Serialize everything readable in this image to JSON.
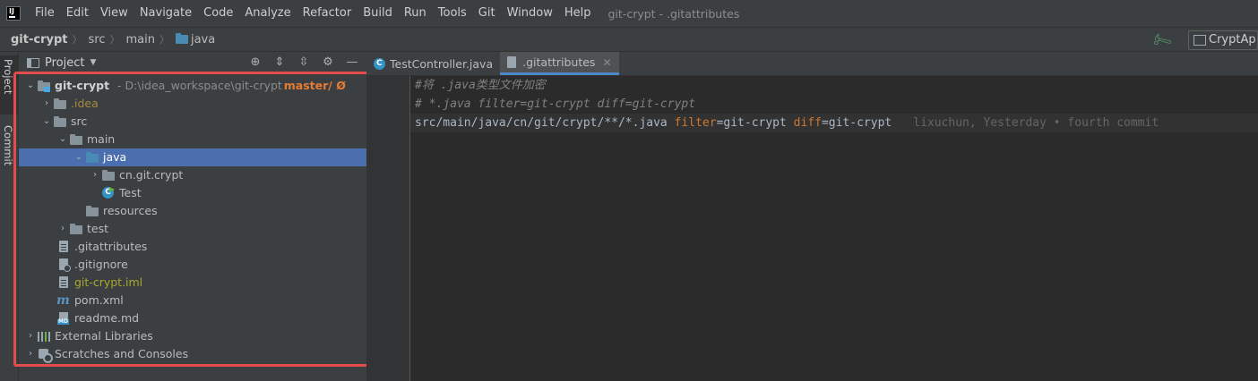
{
  "menubar": {
    "items": [
      "File",
      "Edit",
      "View",
      "Navigate",
      "Code",
      "Analyze",
      "Refactor",
      "Build",
      "Run",
      "Tools",
      "Git",
      "Window",
      "Help"
    ],
    "window_title": "git-crypt - .gitattributes"
  },
  "navbar": {
    "crumbs": [
      "git-crypt",
      "src",
      "main",
      "java"
    ],
    "run_config": "CryptAp"
  },
  "side_strip": {
    "project": "Project",
    "commit": "Commit"
  },
  "project_panel": {
    "title": "Project",
    "tree": {
      "root_name": "git-crypt",
      "root_path": "- D:\\idea_workspace\\git-crypt",
      "root_branch": "master/ Ø",
      "idea": ".idea",
      "src": "src",
      "main": "main",
      "java": "java",
      "pkg": "cn.git.crypt",
      "test_class": "Test",
      "resources": "resources",
      "test": "test",
      "gitattributes": ".gitattributes",
      "gitignore": ".gitignore",
      "iml": "git-crypt.iml",
      "pom": "pom.xml",
      "readme": "readme.md",
      "ext_libs": "External Libraries",
      "scratches": "Scratches and Consoles"
    }
  },
  "editor": {
    "tabs": [
      "TestController.java",
      ".gitattributes"
    ],
    "active_tab": 1,
    "lines": {
      "l1": "#将 .java类型文件加密",
      "l2": "# *.java filter=git-crypt diff=git-crypt",
      "l3_path": "src/main/java/cn/git/crypt/**/*.java ",
      "l3_filter_key": "filter",
      "l3_filter_val": "=git-crypt ",
      "l3_diff_key": "diff",
      "l3_diff_val": "=git-crypt",
      "l3_blame": "lixuchun, Yesterday • fourth commit"
    }
  },
  "colors": {
    "highlight_box": "#e64b4b",
    "selection": "#4b6eaf",
    "keyword": "#cc7832"
  }
}
